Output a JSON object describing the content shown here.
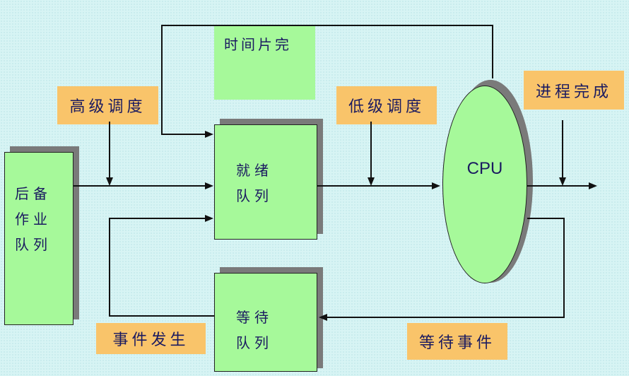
{
  "nodes": {
    "backup_queue": [
      "后备",
      "作业",
      "队列"
    ],
    "ready_queue": [
      "就绪",
      "队列"
    ],
    "wait_queue": [
      "等待",
      "队列"
    ],
    "timeslice_box": "时间片完",
    "cpu": "CPU"
  },
  "labels": {
    "high_level_scheduling": "高级调度",
    "low_level_scheduling": "低级调度",
    "process_complete": "进程完成",
    "event_occurs": "事件发生",
    "wait_event": "等待事件"
  },
  "colors": {
    "node_fill": "#a6f99a",
    "label_fill": "#f9c46a",
    "shadow": "#7a7a7a",
    "text": "#1a1a60",
    "background": "#d7f4f4"
  }
}
